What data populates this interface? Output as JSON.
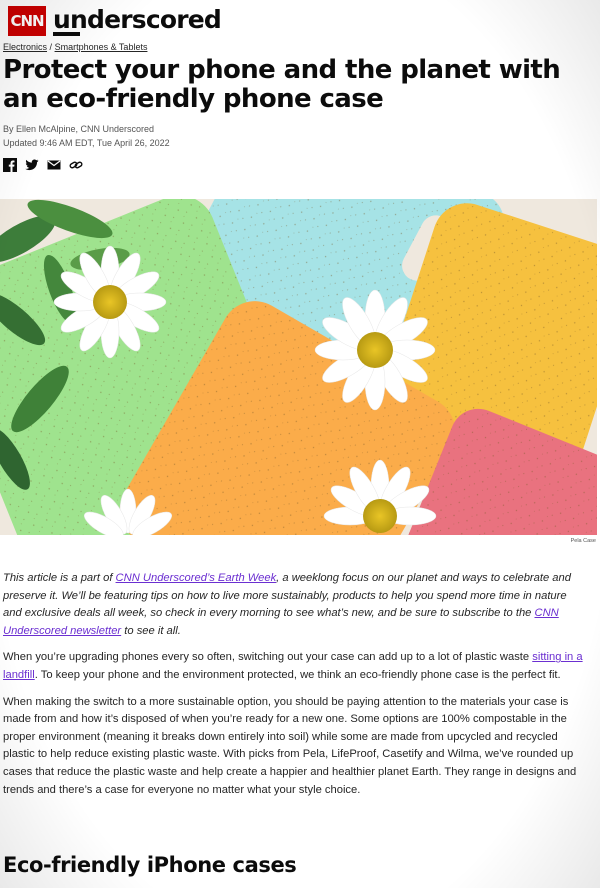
{
  "header": {
    "logo_text": "CNN",
    "brand": "underscored"
  },
  "breadcrumb": {
    "items": [
      "Electronics",
      "Smartphones & Tablets"
    ],
    "separator": "/"
  },
  "article": {
    "title": "Protect your phone and the planet with an eco-friendly phone case",
    "byline": "By Ellen McAlpine, CNN Underscored",
    "updated": "Updated 9:46 AM EDT, Tue April 26, 2022",
    "share_icons": [
      "facebook-icon",
      "twitter-icon",
      "email-icon",
      "link-icon"
    ],
    "image_caption": "Pela Case",
    "intro": {
      "t1": "This article is a part of ",
      "link1": "CNN Underscored’s Earth Week",
      "t2": ", a weeklong focus on our planet and ways to celebrate and preserve it. We’ll be featuring tips on how to live more sustainably, products to help you spend more time in nature and exclusive deals all week, so check in every morning to see what’s new, and be sure to subscribe to the ",
      "link2": "CNN Underscored newsletter",
      "t3": " to see it all."
    },
    "p2": {
      "t1": "When you’re upgrading phones every so often, switching out your case can add up to a lot of plastic waste ",
      "link": "sitting in a landfill",
      "t2": ". To keep your phone and the environment protected, we think an eco-friendly phone case is the perfect fit."
    },
    "p3": "When making the switch to a more sustainable option, you should be paying attention to the materials your case is made from and how it’s disposed of when you’re ready for a new one. Some options are 100% compostable in the proper environment (meaning it breaks down entirely into soil) while some are made from upcycled and recycled plastic to help reduce existing plastic waste. With picks from Pela, LifeProof, Casetify and Wilma, we’ve rounded up cases that reduce the plastic waste and help create a happier and healthier planet Earth. They range in designs and trends and there’s a case for everyone no matter what your style choice.",
    "section_heading": "Eco-friendly iPhone cases"
  },
  "colors": {
    "brand_red": "#cc0000",
    "link_purple": "#6b2fd1",
    "case_green": "#9fe38e",
    "case_blue": "#a6e3e6",
    "case_yellow": "#f6c13f",
    "case_orange": "#fbac4a",
    "case_pink": "#e9727f"
  }
}
